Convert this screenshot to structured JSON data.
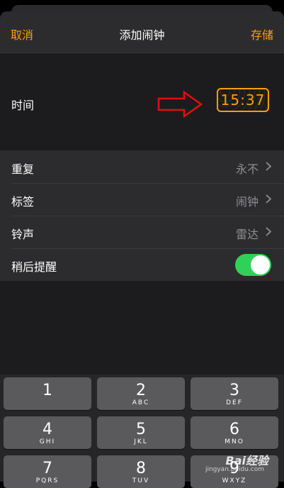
{
  "navbar": {
    "cancel_label": "取消",
    "title": "添加闹钟",
    "save_label": "存储"
  },
  "time_section": {
    "label": "时间",
    "value": "15:37"
  },
  "settings": [
    {
      "label": "重复",
      "value": "永不"
    },
    {
      "label": "标签",
      "value": "闹钟"
    },
    {
      "label": "铃声",
      "value": "雷达"
    }
  ],
  "snooze": {
    "label": "稍后提醒",
    "enabled": true
  },
  "keypad": {
    "keys": [
      {
        "num": "1",
        "letters": ""
      },
      {
        "num": "2",
        "letters": "ABC"
      },
      {
        "num": "3",
        "letters": "DEF"
      },
      {
        "num": "4",
        "letters": "GHI"
      },
      {
        "num": "5",
        "letters": "JKL"
      },
      {
        "num": "6",
        "letters": "MNO"
      },
      {
        "num": "7",
        "letters": "PQRS"
      },
      {
        "num": "8",
        "letters": "TUV"
      },
      {
        "num": "9",
        "letters": "WXYZ"
      }
    ]
  },
  "watermark": {
    "text": "Bai经验",
    "sub": "jingyan.baidu.com"
  },
  "colors": {
    "accent": "#ff9f0a",
    "toggle_on": "#30d158",
    "annotation_arrow": "#e01010"
  }
}
